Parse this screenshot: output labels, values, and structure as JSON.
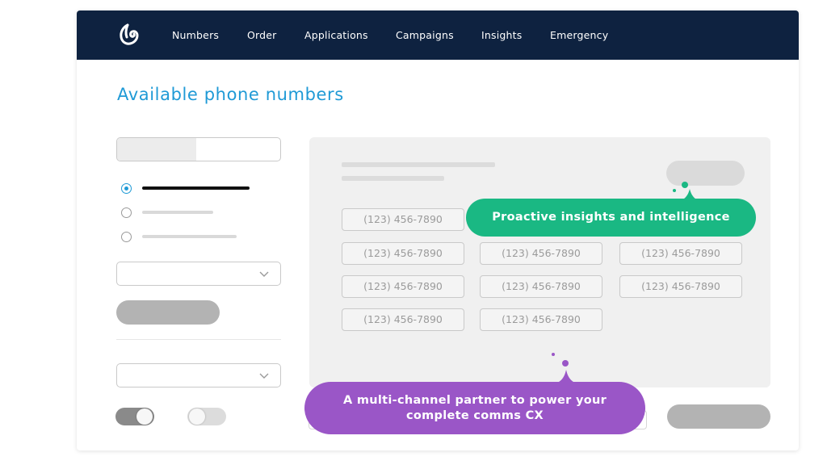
{
  "nav": {
    "brand_icon": "brand-logo-icon",
    "items": [
      "Numbers",
      "Order",
      "Applications",
      "Campaigns",
      "Insights",
      "Emergency"
    ]
  },
  "page": {
    "title": "Available phone numbers"
  },
  "sidebar": {
    "options": [
      {
        "selected": true
      },
      {
        "selected": false
      },
      {
        "selected": false
      }
    ],
    "dropdown_icon": "chevron-down-icon",
    "toggles": [
      {
        "state": "on"
      },
      {
        "state": "off"
      }
    ]
  },
  "numbers": {
    "row_1": [
      "(123) 456-7890"
    ],
    "row_2": [
      "(123) 456-7890",
      "(123) 456-7890",
      "(123) 456-7890"
    ],
    "row_3": [
      "(123) 456-7890",
      "(123) 456-7890",
      "(123) 456-7890"
    ],
    "row_4": [
      "(123) 456-7890",
      "(123) 456-7890"
    ]
  },
  "callouts": {
    "insights": "Proactive insights and intelligence",
    "partner_line_1": "A multi-channel partner to power your",
    "partner_line_2": "complete comms CX"
  },
  "colors": {
    "navbar": "#0e2240",
    "accent_blue": "#1f9ad6",
    "callout_green": "#1ab883",
    "callout_purple": "#9a56c7",
    "placeholder_gray": "#b3b3b3"
  }
}
